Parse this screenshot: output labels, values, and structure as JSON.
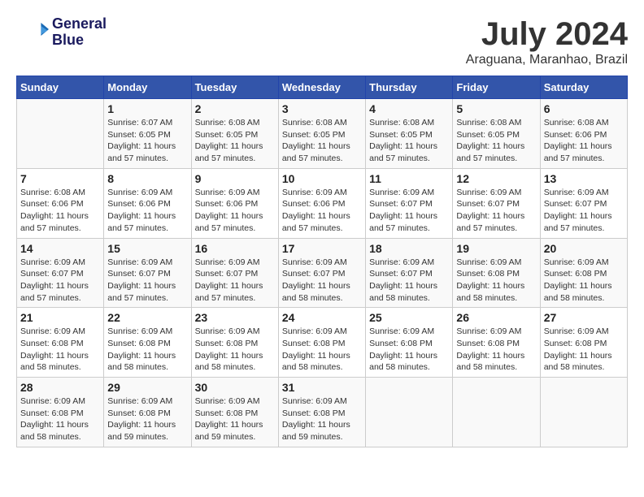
{
  "header": {
    "logo_line1": "General",
    "logo_line2": "Blue",
    "month_title": "July 2024",
    "location": "Araguana, Maranhao, Brazil"
  },
  "days_of_week": [
    "Sunday",
    "Monday",
    "Tuesday",
    "Wednesday",
    "Thursday",
    "Friday",
    "Saturday"
  ],
  "weeks": [
    [
      {
        "day": "",
        "sunrise": "",
        "sunset": "",
        "daylight": ""
      },
      {
        "day": "1",
        "sunrise": "Sunrise: 6:07 AM",
        "sunset": "Sunset: 6:05 PM",
        "daylight": "Daylight: 11 hours and 57 minutes."
      },
      {
        "day": "2",
        "sunrise": "Sunrise: 6:08 AM",
        "sunset": "Sunset: 6:05 PM",
        "daylight": "Daylight: 11 hours and 57 minutes."
      },
      {
        "day": "3",
        "sunrise": "Sunrise: 6:08 AM",
        "sunset": "Sunset: 6:05 PM",
        "daylight": "Daylight: 11 hours and 57 minutes."
      },
      {
        "day": "4",
        "sunrise": "Sunrise: 6:08 AM",
        "sunset": "Sunset: 6:05 PM",
        "daylight": "Daylight: 11 hours and 57 minutes."
      },
      {
        "day": "5",
        "sunrise": "Sunrise: 6:08 AM",
        "sunset": "Sunset: 6:05 PM",
        "daylight": "Daylight: 11 hours and 57 minutes."
      },
      {
        "day": "6",
        "sunrise": "Sunrise: 6:08 AM",
        "sunset": "Sunset: 6:06 PM",
        "daylight": "Daylight: 11 hours and 57 minutes."
      }
    ],
    [
      {
        "day": "7",
        "sunrise": "Sunrise: 6:08 AM",
        "sunset": "Sunset: 6:06 PM",
        "daylight": "Daylight: 11 hours and 57 minutes."
      },
      {
        "day": "8",
        "sunrise": "Sunrise: 6:09 AM",
        "sunset": "Sunset: 6:06 PM",
        "daylight": "Daylight: 11 hours and 57 minutes."
      },
      {
        "day": "9",
        "sunrise": "Sunrise: 6:09 AM",
        "sunset": "Sunset: 6:06 PM",
        "daylight": "Daylight: 11 hours and 57 minutes."
      },
      {
        "day": "10",
        "sunrise": "Sunrise: 6:09 AM",
        "sunset": "Sunset: 6:06 PM",
        "daylight": "Daylight: 11 hours and 57 minutes."
      },
      {
        "day": "11",
        "sunrise": "Sunrise: 6:09 AM",
        "sunset": "Sunset: 6:07 PM",
        "daylight": "Daylight: 11 hours and 57 minutes."
      },
      {
        "day": "12",
        "sunrise": "Sunrise: 6:09 AM",
        "sunset": "Sunset: 6:07 PM",
        "daylight": "Daylight: 11 hours and 57 minutes."
      },
      {
        "day": "13",
        "sunrise": "Sunrise: 6:09 AM",
        "sunset": "Sunset: 6:07 PM",
        "daylight": "Daylight: 11 hours and 57 minutes."
      }
    ],
    [
      {
        "day": "14",
        "sunrise": "Sunrise: 6:09 AM",
        "sunset": "Sunset: 6:07 PM",
        "daylight": "Daylight: 11 hours and 57 minutes."
      },
      {
        "day": "15",
        "sunrise": "Sunrise: 6:09 AM",
        "sunset": "Sunset: 6:07 PM",
        "daylight": "Daylight: 11 hours and 57 minutes."
      },
      {
        "day": "16",
        "sunrise": "Sunrise: 6:09 AM",
        "sunset": "Sunset: 6:07 PM",
        "daylight": "Daylight: 11 hours and 57 minutes."
      },
      {
        "day": "17",
        "sunrise": "Sunrise: 6:09 AM",
        "sunset": "Sunset: 6:07 PM",
        "daylight": "Daylight: 11 hours and 58 minutes."
      },
      {
        "day": "18",
        "sunrise": "Sunrise: 6:09 AM",
        "sunset": "Sunset: 6:07 PM",
        "daylight": "Daylight: 11 hours and 58 minutes."
      },
      {
        "day": "19",
        "sunrise": "Sunrise: 6:09 AM",
        "sunset": "Sunset: 6:08 PM",
        "daylight": "Daylight: 11 hours and 58 minutes."
      },
      {
        "day": "20",
        "sunrise": "Sunrise: 6:09 AM",
        "sunset": "Sunset: 6:08 PM",
        "daylight": "Daylight: 11 hours and 58 minutes."
      }
    ],
    [
      {
        "day": "21",
        "sunrise": "Sunrise: 6:09 AM",
        "sunset": "Sunset: 6:08 PM",
        "daylight": "Daylight: 11 hours and 58 minutes."
      },
      {
        "day": "22",
        "sunrise": "Sunrise: 6:09 AM",
        "sunset": "Sunset: 6:08 PM",
        "daylight": "Daylight: 11 hours and 58 minutes."
      },
      {
        "day": "23",
        "sunrise": "Sunrise: 6:09 AM",
        "sunset": "Sunset: 6:08 PM",
        "daylight": "Daylight: 11 hours and 58 minutes."
      },
      {
        "day": "24",
        "sunrise": "Sunrise: 6:09 AM",
        "sunset": "Sunset: 6:08 PM",
        "daylight": "Daylight: 11 hours and 58 minutes."
      },
      {
        "day": "25",
        "sunrise": "Sunrise: 6:09 AM",
        "sunset": "Sunset: 6:08 PM",
        "daylight": "Daylight: 11 hours and 58 minutes."
      },
      {
        "day": "26",
        "sunrise": "Sunrise: 6:09 AM",
        "sunset": "Sunset: 6:08 PM",
        "daylight": "Daylight: 11 hours and 58 minutes."
      },
      {
        "day": "27",
        "sunrise": "Sunrise: 6:09 AM",
        "sunset": "Sunset: 6:08 PM",
        "daylight": "Daylight: 11 hours and 58 minutes."
      }
    ],
    [
      {
        "day": "28",
        "sunrise": "Sunrise: 6:09 AM",
        "sunset": "Sunset: 6:08 PM",
        "daylight": "Daylight: 11 hours and 58 minutes."
      },
      {
        "day": "29",
        "sunrise": "Sunrise: 6:09 AM",
        "sunset": "Sunset: 6:08 PM",
        "daylight": "Daylight: 11 hours and 59 minutes."
      },
      {
        "day": "30",
        "sunrise": "Sunrise: 6:09 AM",
        "sunset": "Sunset: 6:08 PM",
        "daylight": "Daylight: 11 hours and 59 minutes."
      },
      {
        "day": "31",
        "sunrise": "Sunrise: 6:09 AM",
        "sunset": "Sunset: 6:08 PM",
        "daylight": "Daylight: 11 hours and 59 minutes."
      },
      {
        "day": "",
        "sunrise": "",
        "sunset": "",
        "daylight": ""
      },
      {
        "day": "",
        "sunrise": "",
        "sunset": "",
        "daylight": ""
      },
      {
        "day": "",
        "sunrise": "",
        "sunset": "",
        "daylight": ""
      }
    ]
  ]
}
